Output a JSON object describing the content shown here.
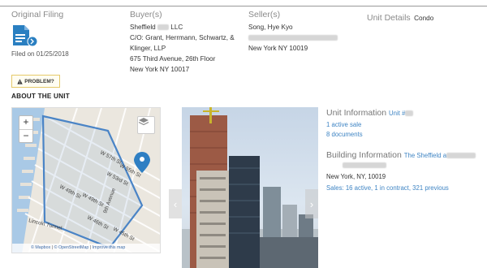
{
  "header": {
    "original_filing": "Original Filing",
    "filed_on": "Filed on 01/25/2018",
    "buyers_label": "Buyer(s)",
    "buyer_name": "Sheffield",
    "buyer_suffix": "LLC",
    "buyer_address": [
      "C/O: Grant, Herrmann, Schwartz, &",
      "Klinger, LLP",
      "675 Third Avenue, 26th Floor",
      "New York NY 10017"
    ],
    "sellers_label": "Seller(s)",
    "seller_name": "Song, Hye Kyo",
    "seller_city": "New York NY 10019",
    "unit_details_label": "Unit Details",
    "unit_details_value": "Condo"
  },
  "problem_button": "PROBLEM?",
  "about_title": "ABOUT THE UNIT",
  "map": {
    "zoom_in": "+",
    "zoom_out": "−",
    "streets": [
      "W 57th St",
      "W 55th St",
      "W 53rd St",
      "W 49th St",
      "W 49th St",
      "W 45th St",
      "W 46th St",
      "9th Avenue",
      "Lincoln Tunnel"
    ],
    "attribution": {
      "mapbox": "© Mapbox",
      "osm": "© OpenStreetMap",
      "improve": "Improve this map"
    }
  },
  "unit_info": {
    "title": "Unit Information",
    "unit_link": "Unit #",
    "active_sale": "1 active sale",
    "documents": "8 documents"
  },
  "building_info": {
    "title": "Building Information",
    "building_link": "The Sheffield a",
    "city": "New York, NY, 10019",
    "sales": "Sales: 16 active, 1 in contract, 321 previous"
  },
  "colors": {
    "link": "#3f85c4",
    "map_outline": "#4a84c6",
    "marker": "#2f7fc3",
    "icon": "#2a7fc1"
  }
}
